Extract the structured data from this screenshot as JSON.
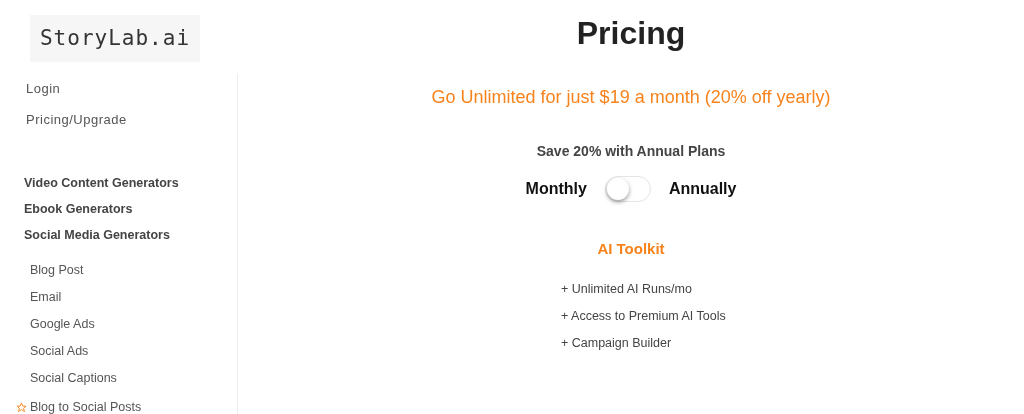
{
  "logo": "StoryLab.ai",
  "sidebar": {
    "account_links": [
      "Login",
      "Pricing/Upgrade"
    ],
    "categories": [
      "Video Content Generators",
      "Ebook Generators",
      "Social Media Generators"
    ],
    "tools": [
      "Blog Post",
      "Email",
      "Google Ads",
      "Social Ads",
      "Social Captions"
    ],
    "featured": "Blog to Social Posts"
  },
  "main": {
    "title": "Pricing",
    "promo": "Go Unlimited for just $19 a month (20% off yearly)",
    "save_note": "Save 20% with Annual Plans",
    "billing_toggle": {
      "left_label": "Monthly",
      "right_label": "Annually",
      "on": false
    },
    "plan": {
      "name": "AI Toolkit",
      "features": [
        "+ Unlimited AI Runs/mo",
        "+ Access to Premium AI Tools",
        "+ Campaign Builder"
      ]
    }
  }
}
